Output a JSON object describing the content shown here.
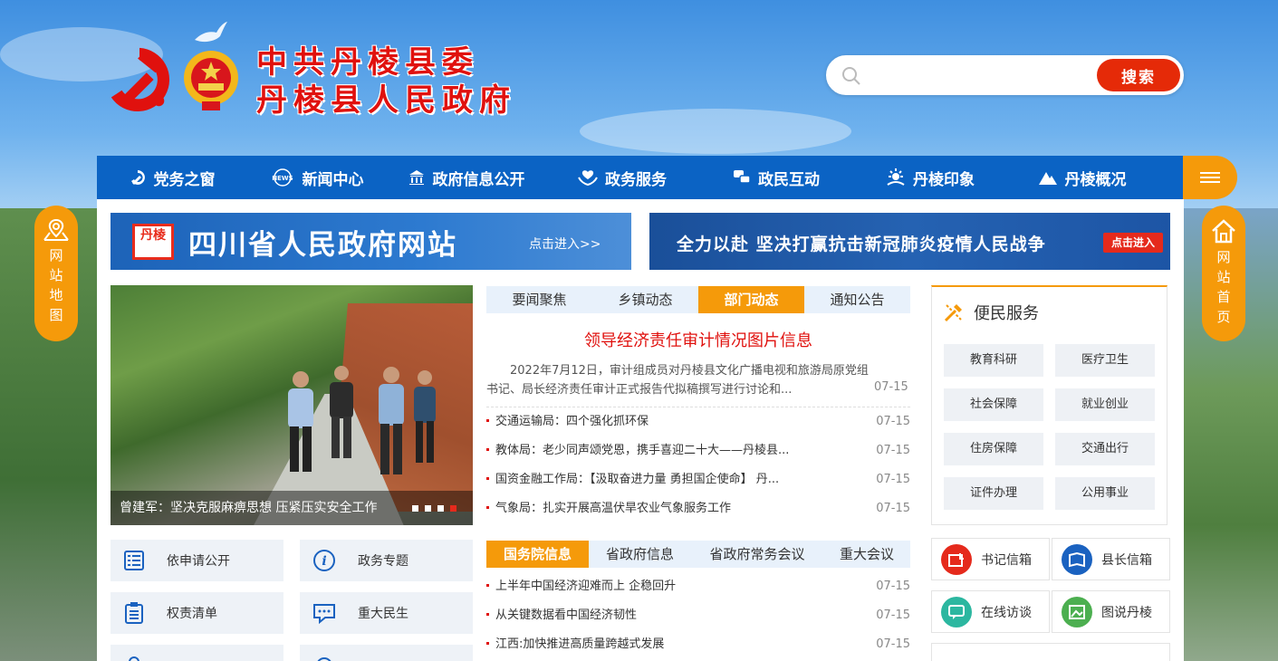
{
  "header": {
    "title_line1": "中共丹棱县委",
    "title_line2": "丹棱县人民政府",
    "search_placeholder": "",
    "search_button": "搜索"
  },
  "nav": {
    "items": [
      {
        "label": "党务之窗",
        "icon": "hammer-sickle-icon"
      },
      {
        "label": "新闻中心",
        "icon": "news-icon"
      },
      {
        "label": "政府信息公开",
        "icon": "building-icon"
      },
      {
        "label": "政务服务",
        "icon": "hands-heart-icon"
      },
      {
        "label": "政民互动",
        "icon": "chat-icon"
      },
      {
        "label": "丹棱印象",
        "icon": "sun-icon"
      },
      {
        "label": "丹棱概况",
        "icon": "mountain-icon"
      }
    ]
  },
  "side": {
    "left_label": "网站地图",
    "right_label": "网站首页"
  },
  "banners": {
    "left_seal": "丹棱",
    "left_title": "四川省人民政府网站",
    "left_enter": "点击进入>>",
    "right_title": "全力以赴 坚决打赢抗击新冠肺炎疫情人民战争",
    "right_enter": "点击进入"
  },
  "carousel": {
    "caption": "曾建军：坚决克服麻痹思想 压紧压实安全工作",
    "dots": 4,
    "active_dot": 4
  },
  "quick_links": [
    {
      "label": "依申请公开",
      "icon": "list-icon"
    },
    {
      "label": "政务专题",
      "icon": "info-icon"
    },
    {
      "label": "权责清单",
      "icon": "clipboard-icon"
    },
    {
      "label": "重大民生",
      "icon": "message-icon"
    }
  ],
  "news_tabs": [
    "要闻聚焦",
    "乡镇动态",
    "部门动态",
    "通知公告"
  ],
  "news_active_tab": 2,
  "headline": {
    "title": "领导经济责任审计情况图片信息",
    "summary": "2022年7月12日，审计组成员对丹棱县文化广播电视和旅游局原党组书记、局长经济责任审计正式报告代拟稿撰写进行讨论和...",
    "date": "07-15"
  },
  "news": [
    {
      "title": "交通运输局：四个强化抓环保",
      "date": "07-15"
    },
    {
      "title": "教体局：老少同声颂党恩，携手喜迎二十大——丹棱县...",
      "date": "07-15"
    },
    {
      "title": "国资金融工作局：【汲取奋进力量 勇担国企使命】 丹...",
      "date": "07-15"
    },
    {
      "title": "气象局：扎实开展高温伏旱农业气象服务工作",
      "date": "07-15"
    }
  ],
  "state_tabs": [
    "国务院信息",
    "省政府信息",
    "省政府常务会议",
    "重大会议"
  ],
  "state_active_tab": 0,
  "state_news": [
    {
      "title": "上半年中国经济迎难而上 企稳回升",
      "date": "07-15"
    },
    {
      "title": "从关键数据看中国经济韧性",
      "date": "07-15"
    },
    {
      "title": "江西:加快推进高质量跨越式发展",
      "date": "07-15"
    }
  ],
  "service": {
    "title": "便民服务",
    "items": [
      "教育科研",
      "医疗卫生",
      "社会保障",
      "就业创业",
      "住房保障",
      "交通出行",
      "证件办理",
      "公用事业"
    ]
  },
  "mailboxes": [
    {
      "label": "书记信箱",
      "color": "#e52a1c"
    },
    {
      "label": "县长信箱",
      "color": "#1a62c0"
    },
    {
      "label": "在线访谈",
      "color": "#2cb7a0"
    },
    {
      "label": "图说丹棱",
      "color": "#4caf50"
    }
  ],
  "colors": {
    "brand_blue": "#0b63c4",
    "accent_orange": "#f59a0a",
    "red": "#e0110e"
  }
}
